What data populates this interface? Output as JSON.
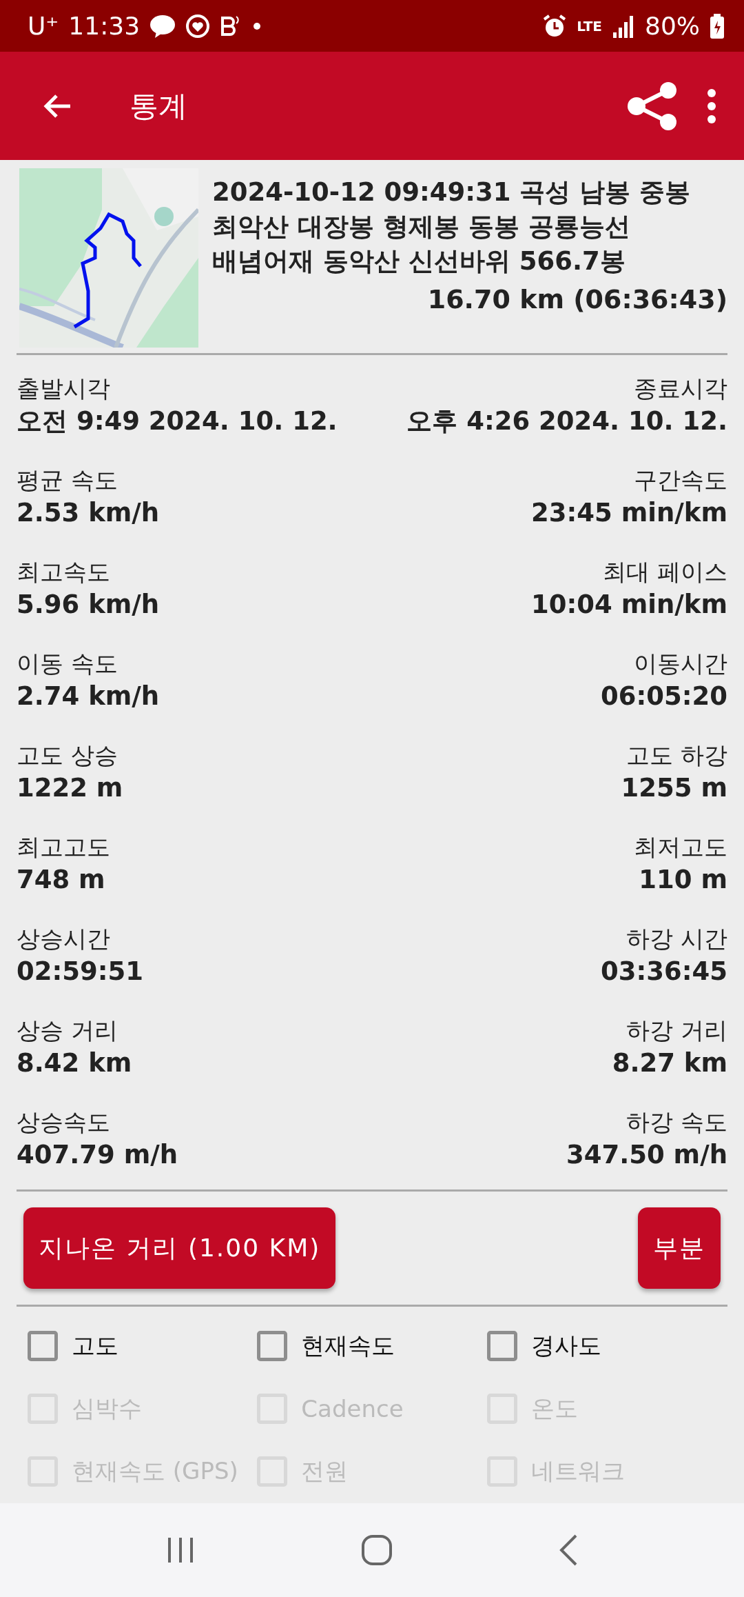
{
  "status_bar": {
    "carrier": "U⁺",
    "time": "11:33",
    "battery": "80%",
    "network": "LTE"
  },
  "app_bar": {
    "title": "통계"
  },
  "summary": {
    "title": "2024-10-12 09:49:31 곡성 남봉 중봉 최악산 대장봉 형제봉 동봉 공룡능선 배념어재 동악산 신선바위 566.7봉",
    "distance": "16.70 km (06:36:43)"
  },
  "stats": [
    {
      "left_label": "출발시각",
      "left_value": "오전 9:49 2024. 10. 12.",
      "right_label": "종료시각",
      "right_value": "오후 4:26 2024. 10. 12."
    },
    {
      "left_label": "평균 속도",
      "left_value": "2.53 km/h",
      "right_label": "구간속도",
      "right_value": "23:45 min/km"
    },
    {
      "left_label": "최고속도",
      "left_value": "5.96 km/h",
      "right_label": "최대 페이스",
      "right_value": "10:04 min/km"
    },
    {
      "left_label": "이동 속도",
      "left_value": "2.74 km/h",
      "right_label": "이동시간",
      "right_value": "06:05:20"
    },
    {
      "left_label": "고도 상승",
      "left_value": "1222 m",
      "right_label": "고도 하강",
      "right_value": "1255 m"
    },
    {
      "left_label": "최고고도",
      "left_value": "748 m",
      "right_label": "최저고도",
      "right_value": "110 m"
    },
    {
      "left_label": "상승시간",
      "left_value": "02:59:51",
      "right_label": "하강 시간",
      "right_value": "03:36:45"
    },
    {
      "left_label": "상승 거리",
      "left_value": "8.42 km",
      "right_label": "하강 거리",
      "right_value": "8.27 km"
    },
    {
      "left_label": "상승속도",
      "left_value": "407.79 m/h",
      "right_label": "하강 속도",
      "right_value": "347.50 m/h"
    }
  ],
  "buttons": [
    "지나온 거리 (1.00  KM)",
    "부분"
  ],
  "checkboxes": [
    {
      "label": "고도",
      "checked": false,
      "disabled": false
    },
    {
      "label": "현재속도",
      "checked": false,
      "disabled": false
    },
    {
      "label": "경사도",
      "checked": false,
      "disabled": false
    },
    {
      "label": "심박수",
      "checked": false,
      "disabled": true
    },
    {
      "label": "Cadence",
      "checked": false,
      "disabled": true
    },
    {
      "label": "온도",
      "checked": false,
      "disabled": true
    },
    {
      "label": "현재속도 (GPS)",
      "checked": false,
      "disabled": true
    },
    {
      "label": "전원",
      "checked": false,
      "disabled": true
    },
    {
      "label": "네트워크",
      "checked": false,
      "disabled": true
    }
  ]
}
